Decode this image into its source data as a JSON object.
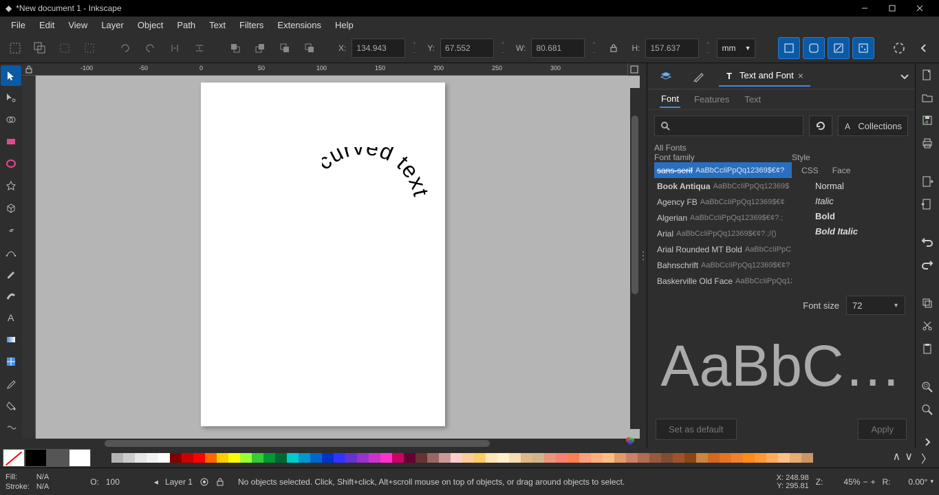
{
  "title": "*New document 1 - Inkscape",
  "menu": [
    "File",
    "Edit",
    "View",
    "Layer",
    "Object",
    "Path",
    "Text",
    "Filters",
    "Extensions",
    "Help"
  ],
  "toolbar": {
    "x_label": "X:",
    "x_value": "134.943",
    "y_label": "Y:",
    "y_value": "67.552",
    "w_label": "W:",
    "w_value": "80.681",
    "h_label": "H:",
    "h_value": "157.637",
    "unit": "mm"
  },
  "ruler_ticks": [
    "-100",
    "-50",
    "0",
    "50",
    "100",
    "150",
    "200",
    "250",
    "300"
  ],
  "canvas_text": "curved text",
  "panel": {
    "tab_layers": "",
    "tab_fill": "",
    "tab_text": "Text and Font",
    "subtabs": {
      "font": "Font",
      "features": "Features",
      "text": "Text"
    },
    "collections": "Collections",
    "all_fonts": "All Fonts",
    "font_family_label": "Font family",
    "style_label": "Style",
    "css_label": "CSS",
    "face_label": "Face",
    "fonts": [
      {
        "name": "sans-serif",
        "sample": "AaBbCcIiPpQq12369$€¢?"
      },
      {
        "name": "Book Antiqua",
        "sample": "AaBbCcIiPpQq12369$"
      },
      {
        "name": "Agency FB",
        "sample": "AaBbCcIiPpQq12369$€¢"
      },
      {
        "name": "Algerian",
        "sample": "AaBbCcIiPpQq12369$€¢?.;"
      },
      {
        "name": "Arial",
        "sample": "AaBbCcIiPpQq12369$€¢?.;/()"
      },
      {
        "name": "Arial Rounded MT Bold",
        "sample": "AaBbCcIiPpC"
      },
      {
        "name": "Bahnschrift",
        "sample": "AaBbCcIiPpQq12369$€¢?"
      },
      {
        "name": "Baskerville Old Face",
        "sample": "AaBbCcIiPpQq12"
      }
    ],
    "styles": {
      "normal": "Normal",
      "italic": "Italic",
      "bold": "Bold",
      "bold_italic": "Bold Italic"
    },
    "font_size_label": "Font size",
    "font_size_value": "72",
    "preview": "AaBbC…",
    "set_default": "Set as default",
    "apply": "Apply"
  },
  "palette_big": [
    "#000000",
    "#555555",
    "#ffffff"
  ],
  "palette": [
    "#b3b3b3",
    "#cccccc",
    "#e6e6e6",
    "#f2f2f2",
    "#ffffff",
    "#800000",
    "#cc0000",
    "#ff0000",
    "#ff6600",
    "#ffcc00",
    "#ffff00",
    "#99ff33",
    "#33cc33",
    "#009933",
    "#006633",
    "#00cccc",
    "#0099cc",
    "#0066cc",
    "#0033cc",
    "#3333ff",
    "#6633cc",
    "#9933cc",
    "#cc33cc",
    "#ff33cc",
    "#cc0066",
    "#660033",
    "#663333",
    "#996666",
    "#cc9999",
    "#ffcccc",
    "#ffcc99",
    "#ffcc66",
    "#ffe6b3",
    "#fff0cc",
    "#f5deb3",
    "#deb887",
    "#d2b48c",
    "#e9967a",
    "#fa8072",
    "#ff7f50",
    "#ffa07a",
    "#ffb07a",
    "#ffbf80",
    "#e69966",
    "#cc8066",
    "#b36b52",
    "#99593d",
    "#804d33",
    "#a0522d",
    "#8b4513",
    "#cd853f",
    "#d2691e",
    "#e67326",
    "#f08030",
    "#ff8c1a",
    "#ff9933",
    "#ffad5c",
    "#ffc085",
    "#e6ac73",
    "#cc9666"
  ],
  "status": {
    "fill_label": "Fill:",
    "stroke_label": "Stroke:",
    "na": "N/A",
    "opacity_label": "O:",
    "opacity_value": "100",
    "layer": "Layer 1",
    "message": "No objects selected. Click, Shift+click, Alt+scroll mouse on top of objects, or drag around objects to select.",
    "x_label": "X:",
    "y_label": "Y:",
    "x_value": "248.98",
    "y_value": "295.81",
    "z_label": "Z:",
    "z_value": "45%",
    "r_label": "R:",
    "r_value": "0.00°"
  }
}
